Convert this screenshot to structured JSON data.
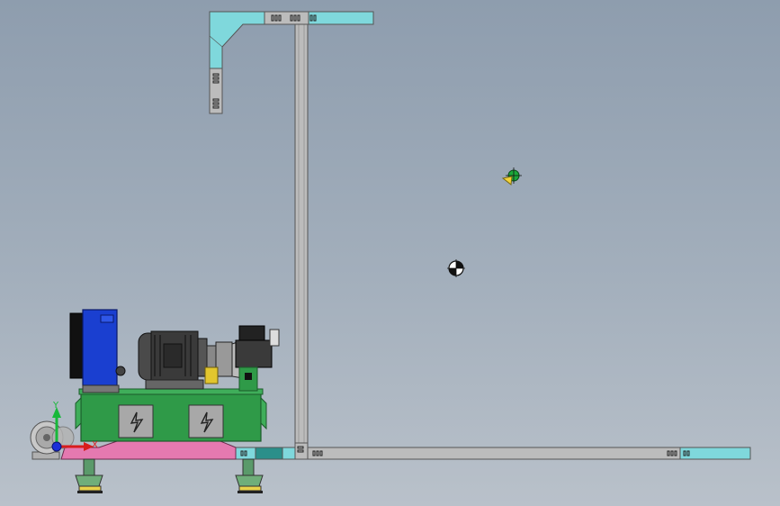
{
  "viewport": {
    "background_top": "#8e9dae",
    "background_bottom": "#b9c1ca"
  },
  "colors": {
    "frame_cyan": "#7fd8dc",
    "frame_gray": "#bcbcbc",
    "tank_green": "#2f9a48",
    "base_pink": "#e579b0",
    "motor_dark": "#3a3a3a",
    "reservoir_blue": "#1a3fd0",
    "axis_x": "#d81c1c",
    "axis_y": "#18b83a",
    "axis_z": "#1c2fd8"
  },
  "triad": {
    "x_label": "X",
    "y_label": "Y"
  },
  "icons": {
    "tank_left_panel": "electrical-hazard-icon",
    "tank_right_panel": "electrical-hazard-icon",
    "origin_marker": "center-of-mass-icon",
    "light_marker": "light-source-icon"
  }
}
